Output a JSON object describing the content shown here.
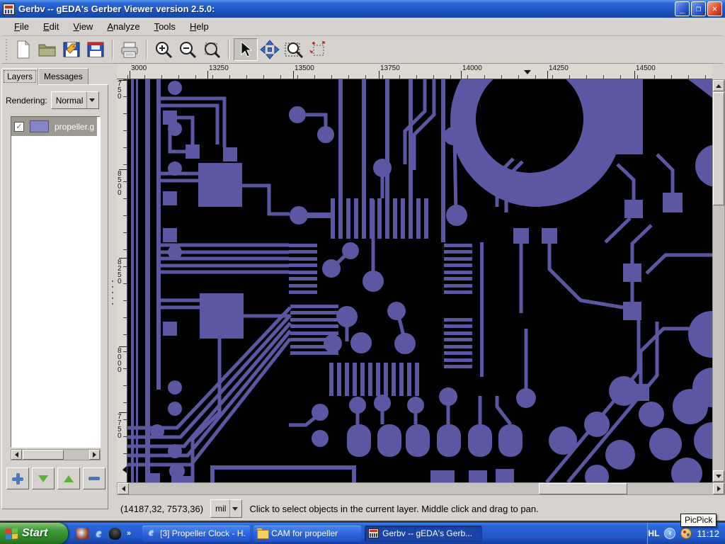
{
  "window": {
    "title": "Gerbv -- gEDA's Gerber Viewer version 2.5.0:"
  },
  "menu": {
    "items": [
      {
        "label": "File"
      },
      {
        "label": "Edit"
      },
      {
        "label": "View"
      },
      {
        "label": "Analyze"
      },
      {
        "label": "Tools"
      },
      {
        "label": "Help"
      }
    ]
  },
  "left_panel": {
    "tabs": [
      {
        "label": "Layers"
      },
      {
        "label": "Messages"
      }
    ],
    "rendering_label": "Rendering:",
    "rendering_value": "Normal",
    "layer": {
      "name": "propeller.g",
      "visible": true,
      "check_glyph": "✓",
      "swatch_color": "#8486c8"
    }
  },
  "rulers": {
    "horizontal_labels": [
      "3000",
      "13250",
      "13500",
      "13750",
      "14000",
      "14250",
      "14500"
    ],
    "vertical_labels": [
      "750",
      "8500",
      "8250",
      "8000",
      "7750"
    ]
  },
  "status_bar": {
    "coordinates": "(14187,32,  7573,36)",
    "units": "mil",
    "message": "Click to select objects in the current layer. Middle click and drag to pan."
  },
  "taskbar": {
    "start_label": "Start",
    "quick_launch_more": "»",
    "tasks": [
      {
        "label": "[3] Propeller Clock - H...",
        "icon": "ie"
      },
      {
        "label": "CAM for propeller",
        "icon": "folder"
      },
      {
        "label": "Gerbv -- gEDA's Gerb...",
        "icon": "gerbv",
        "active": true
      }
    ],
    "tray": {
      "language": "HL",
      "chevron": "‹",
      "time": "11:12",
      "tooltip": "PicPick"
    },
    "ie_glyph": "e"
  },
  "colors": {
    "pcb_trace": "#5b57a2",
    "canvas_bg": "#000000",
    "layer_swatch": "#8486c8",
    "titlebar_blue": "#1d55c4",
    "taskbar_blue": "#2a66d8",
    "start_green": "#3f9c3a",
    "selection_gray": "#9c9990"
  }
}
